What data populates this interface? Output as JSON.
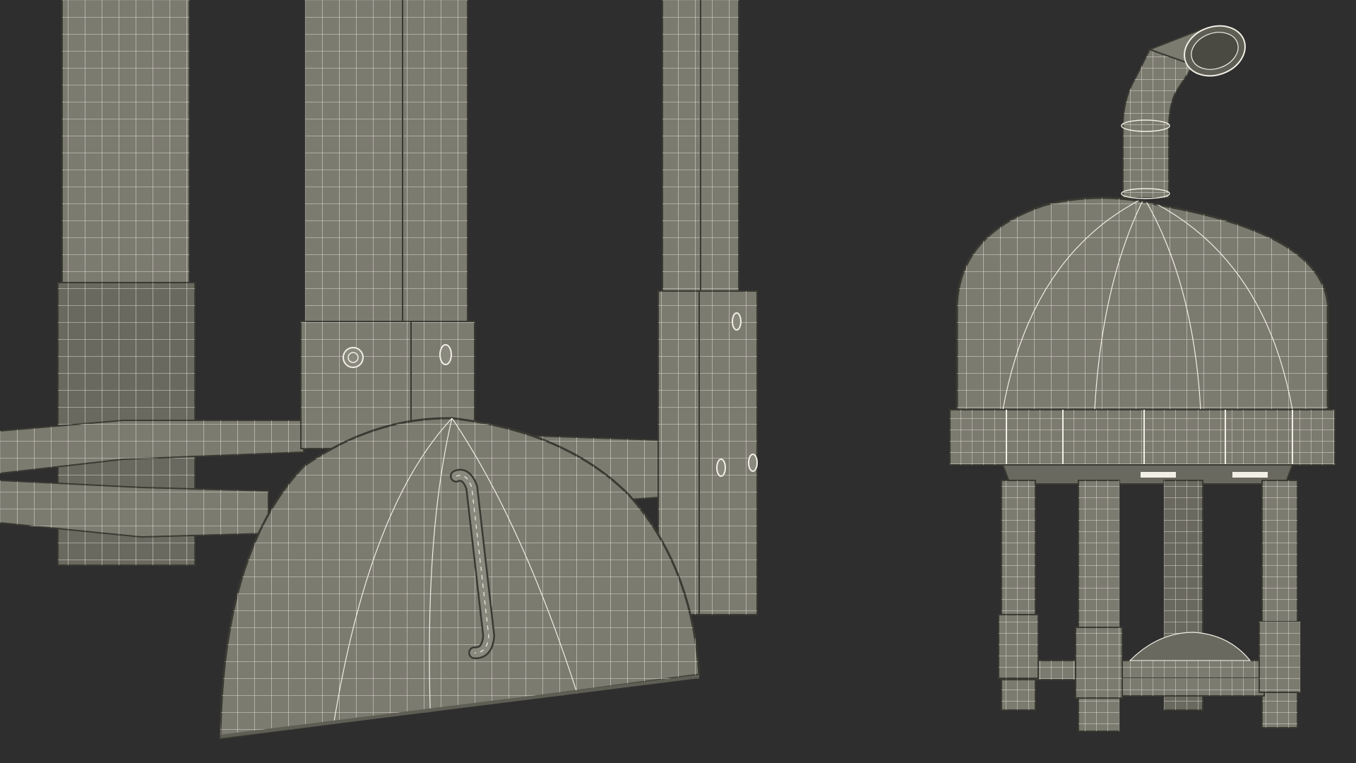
{
  "scene": {
    "background_color": "#2e2e2e",
    "surface_color": "#7c7b70",
    "surface_dark_color": "#6a695f",
    "wire_color": "#f2f0e6",
    "outline_color": "#3a3a33"
  }
}
